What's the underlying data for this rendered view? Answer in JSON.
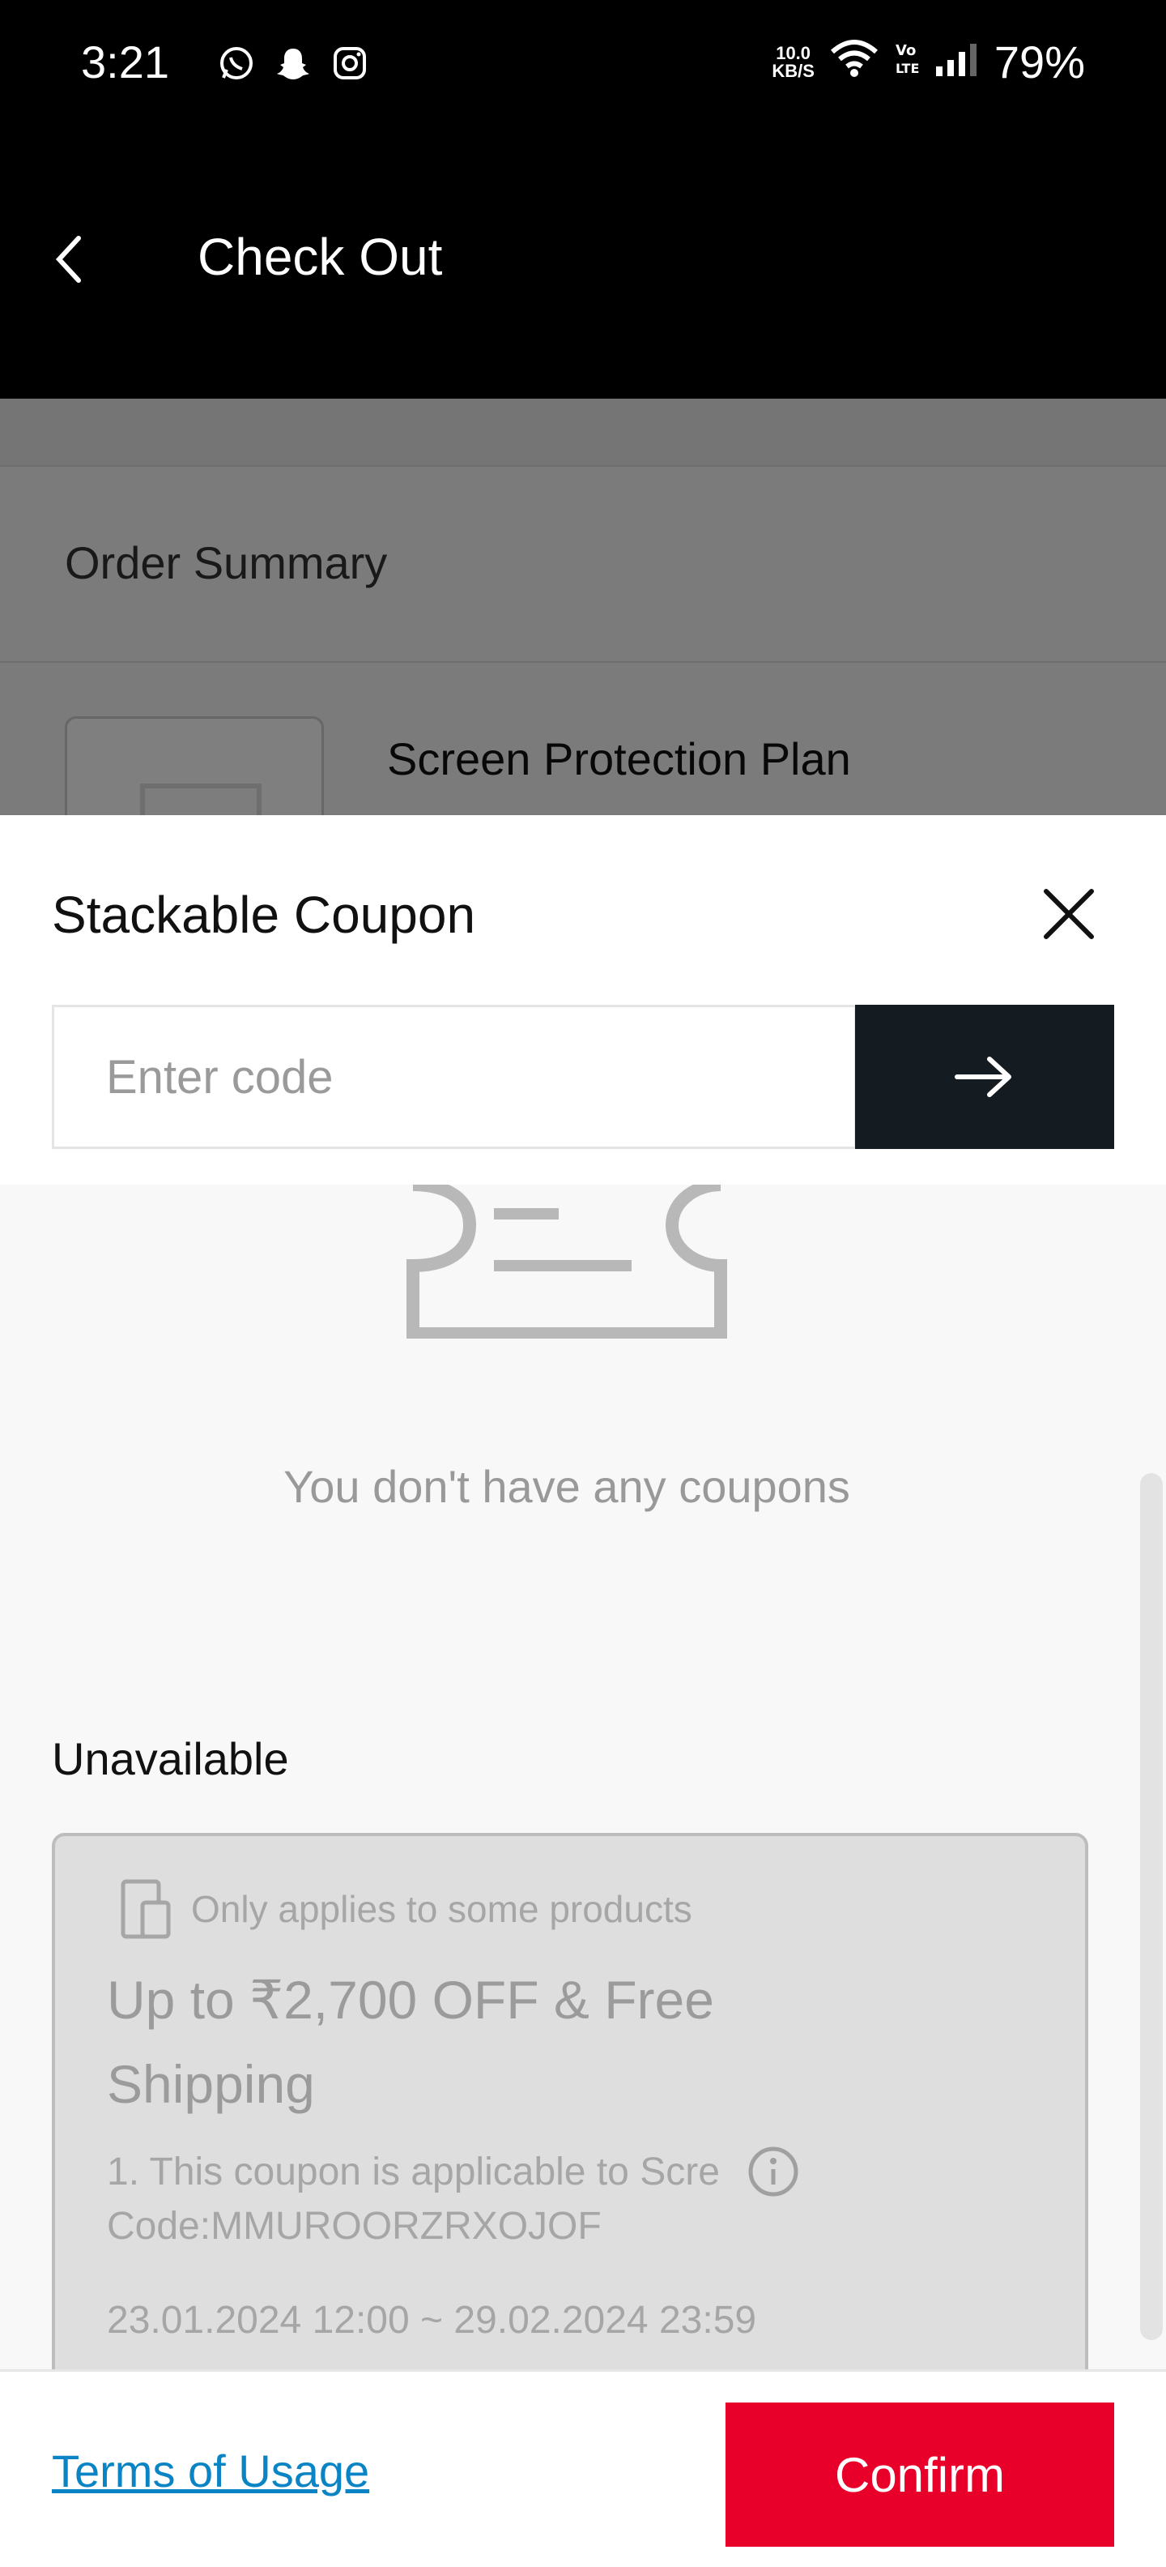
{
  "status_bar": {
    "time": "3:21",
    "app_icons": [
      "whatsapp-icon",
      "snapchat-icon",
      "instagram-icon"
    ],
    "net_speed_value": "10.0",
    "net_speed_unit": "KB/S",
    "battery": "79%"
  },
  "header": {
    "title": "Check Out"
  },
  "background_page": {
    "section_title": "Order Summary",
    "product_name": "Screen Protection Plan"
  },
  "sheet": {
    "title": "Stackable Coupon",
    "code_input_placeholder": "Enter code",
    "empty_message": "You don't have any coupons",
    "unavailable_title": "Unavailable",
    "coupon": {
      "scope": "Only applies to some products",
      "title": "Up to ₹2,700 OFF & Free Shipping",
      "description": "1. This coupon is applicable to Scre",
      "code": "Code:MMUROORZRXOJOF",
      "validity": "23.01.2024 12:00 ~ 29.02.2024 23:59"
    },
    "terms_label": "Terms of Usage",
    "confirm_label": "Confirm"
  },
  "colors": {
    "confirm": "#e8002a",
    "submit": "#141c22",
    "link": "#0a84c4"
  }
}
